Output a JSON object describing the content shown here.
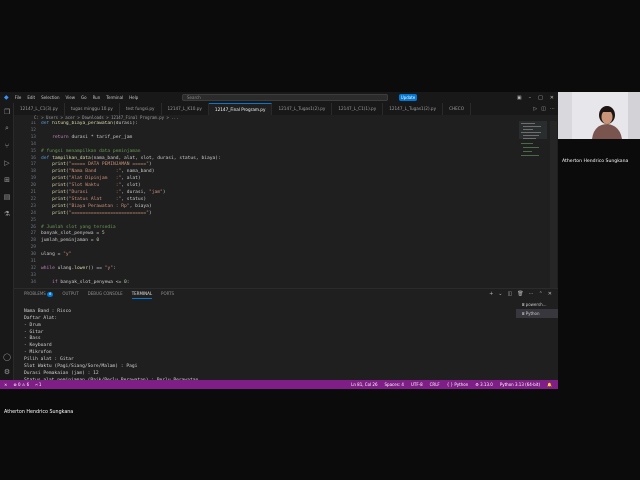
{
  "vscode": {
    "menu": [
      "File",
      "Edit",
      "Selection",
      "View",
      "Go",
      "Run",
      "Terminal",
      "Help"
    ],
    "search_placeholder": "Search",
    "update_label": "Update",
    "tabs": [
      {
        "label": "12147_L_C1(3).py"
      },
      {
        "label": "tugas minggu 10.py"
      },
      {
        "label": "test fungsi.py"
      },
      {
        "label": "12147_L_K10.py"
      },
      {
        "label": "12147_Final Program.py"
      },
      {
        "label": "12147_L_Tugas1(2).py"
      },
      {
        "label": "12147_L_C1(1).py"
      },
      {
        "label": "12147_L_Tugas1(2).py"
      },
      {
        "label": "CHECO"
      }
    ],
    "breadcrumb": "C: > Users > acer > Downloads > 12147_Final Program.py > ...",
    "code_lines": [
      {
        "n": "11",
        "t": "def hitung_biaya_perawatan(durasi):"
      },
      {
        "n": "12",
        "t": ""
      },
      {
        "n": "13",
        "t": "    return durasi * tarif_per_jam"
      },
      {
        "n": "14",
        "t": ""
      },
      {
        "n": "15",
        "t": "# fungsi menampilkan data peminjaman"
      },
      {
        "n": "16",
        "t": "def tampilkan_data(nama_band, alat, slot, durasi, status, biaya):"
      },
      {
        "n": "17",
        "t": "    print(\"===== DATA PEMINJAMAN =====\")"
      },
      {
        "n": "18",
        "t": "    print(\"Nama Band       :\", nama_band)"
      },
      {
        "n": "19",
        "t": "    print(\"Alat Dipinjam   :\", alat)"
      },
      {
        "n": "20",
        "t": "    print(\"Slot Waktu      :\", slot)"
      },
      {
        "n": "21",
        "t": "    print(\"Durasi          :\", durasi, \"jam\")"
      },
      {
        "n": "22",
        "t": "    print(\"Status Alat     :\", status)"
      },
      {
        "n": "23",
        "t": "    print(\"Biaya Perawatan : Rp\", biaya)"
      },
      {
        "n": "24",
        "t": "    print(\"===========================\")"
      },
      {
        "n": "25",
        "t": ""
      },
      {
        "n": "26",
        "t": "# Jumlah slot yang tersedia"
      },
      {
        "n": "27",
        "t": "banyak_slot_penyewa = 5"
      },
      {
        "n": "28",
        "t": "jumlah_peminjaman = 0"
      },
      {
        "n": "29",
        "t": ""
      },
      {
        "n": "30",
        "t": "ulang = \"y\""
      },
      {
        "n": "31",
        "t": ""
      },
      {
        "n": "32",
        "t": "while ulang.lower() == \"y\":"
      },
      {
        "n": "33",
        "t": ""
      },
      {
        "n": "34",
        "t": "    if banyak_slot_penyewa <= 0:"
      }
    ],
    "panel_tabs": [
      {
        "label": "PROBLEMS",
        "badge": "6"
      },
      {
        "label": "OUTPUT"
      },
      {
        "label": "DEBUG CONSOLE"
      },
      {
        "label": "TERMINAL"
      },
      {
        "label": "PORTS"
      }
    ],
    "terminal_lines": [
      "",
      "Nama Band : Risco",
      "Daftar Alat:",
      "- Drum",
      "- Gitar",
      "- Bass",
      "- Keyboard",
      "- Mikrofon",
      "Pilih alat : Gitar",
      "Slot Waktu (Pagi/Siang/Sore/Malam) : Pagi",
      "Durasi Pemakaian (jam) : 12",
      "Status alat peminjaman (Baik/Perlu Perawatan) : Perlu Perawatan",
      "===== DATA PEMINJAMAN ====="
    ],
    "terminal_list": [
      "powersh...",
      "Python"
    ],
    "status_left": [
      "⊗ 0 ⚠ 6",
      "⑁ 1"
    ],
    "status_right": [
      "Ln 81, Col 26",
      "Spaces: 4",
      "UTF-8",
      "CRLF",
      "{ } Python",
      "⚙ 3.13.0",
      "Python 3.13 (64-bit)",
      "🔔"
    ],
    "colors": {
      "accent": "#0078d4",
      "statusbar": "#7f1e86",
      "editor_bg": "#1f1f1f"
    }
  },
  "participant_name": "Atherton Hendrico Sungkana",
  "self_name": "Atherton Hendrico Sungkana"
}
